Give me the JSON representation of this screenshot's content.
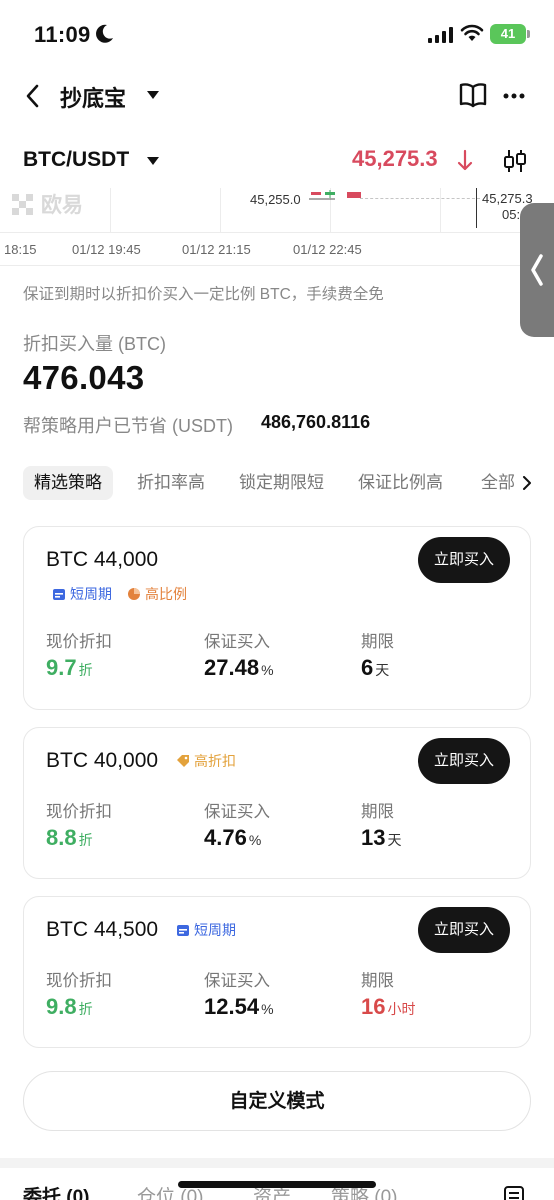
{
  "status_bar": {
    "time": "11:09",
    "battery": "41",
    "icons": [
      "moon-icon",
      "signal-icon",
      "wifi-icon",
      "battery-icon"
    ]
  },
  "nav": {
    "title": "抄底宝",
    "icons": [
      "back-icon",
      "caret-down-icon",
      "book-icon",
      "more-icon"
    ]
  },
  "pair": {
    "name": "BTC/USDT",
    "price": "45,275.3",
    "price_color": "#d84a5e",
    "icons": [
      "arrow-down-icon",
      "candlestick-icon"
    ]
  },
  "chart": {
    "logo_text": "欧易",
    "price_left": "45,255.0",
    "price_right": "45,275.3",
    "small_right": "05:",
    "times": [
      "18:15",
      "01/12 19:45",
      "01/12 21:15",
      "01/12 22:45"
    ]
  },
  "intro_text": "保证到期时以折扣价买入一定比例 BTC，手续费全免",
  "amount": {
    "label": "折扣买入量 (BTC)",
    "value": "476.043"
  },
  "saved": {
    "label": "帮策略用户已节省 (USDT)",
    "value": "486,760.8116"
  },
  "tabs": [
    {
      "label": "精选策略",
      "active": true
    },
    {
      "label": "折扣率高",
      "active": false
    },
    {
      "label": "锁定期限短",
      "active": false
    },
    {
      "label": "保证比例高",
      "active": false
    },
    {
      "label": "全部",
      "active": false
    }
  ],
  "cards": [
    {
      "title": "BTC 44,000",
      "button": "立即买入",
      "tags": [
        {
          "label": "短周期",
          "color": "#3d68e0",
          "icon": "calendar-icon"
        },
        {
          "label": "高比例",
          "color": "#e3823c",
          "icon": "pie-icon"
        }
      ],
      "metrics": [
        {
          "label": "现价折扣",
          "value": "9.7",
          "unit": "折",
          "color": "#3fae62"
        },
        {
          "label": "保证买入",
          "value": "27.48",
          "unit": "%"
        },
        {
          "label": "期限",
          "value": "6",
          "unit": "天"
        }
      ]
    },
    {
      "title": "BTC 40,000",
      "button": "立即买入",
      "tags": [
        {
          "label": "高折扣",
          "color": "#e3a23c",
          "icon": "price-tag-icon"
        }
      ],
      "metrics": [
        {
          "label": "现价折扣",
          "value": "8.8",
          "unit": "折",
          "color": "#3fae62"
        },
        {
          "label": "保证买入",
          "value": "4.76",
          "unit": "%"
        },
        {
          "label": "期限",
          "value": "13",
          "unit": "天"
        }
      ]
    },
    {
      "title": "BTC 44,500",
      "button": "立即买入",
      "tags": [
        {
          "label": "短周期",
          "color": "#3d68e0",
          "icon": "calendar-icon"
        }
      ],
      "metrics": [
        {
          "label": "现价折扣",
          "value": "9.8",
          "unit": "折",
          "color": "#3fae62"
        },
        {
          "label": "保证买入",
          "value": "12.54",
          "unit": "%"
        },
        {
          "label": "期限",
          "value": "16",
          "unit": "小时",
          "color": "#d84a4a"
        }
      ]
    }
  ],
  "custom_button": "自定义模式",
  "bottom_tabs": [
    "委托 (0)",
    "仓位 (0)",
    "资产",
    "策略 (0)"
  ]
}
